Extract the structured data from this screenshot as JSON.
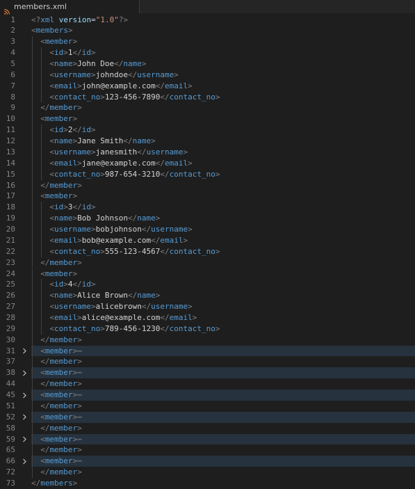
{
  "tab": {
    "filename": "members.xml",
    "icon": "rss-feed-icon"
  },
  "colors": {
    "background": "#1e1e1e",
    "tabbar": "#252526",
    "line_number": "#858585",
    "tag": "#569cd6",
    "punctuation": "#808080",
    "text": "#d4d4d4",
    "string": "#ce9178",
    "attribute": "#9cdcfe",
    "folded_highlight": "#26323d"
  },
  "lines": [
    {
      "n": "1",
      "indent": 0,
      "kind": "decl"
    },
    {
      "n": "2",
      "indent": 0,
      "kind": "open",
      "tag": "members"
    },
    {
      "n": "3",
      "indent": 1,
      "kind": "open",
      "tag": "member"
    },
    {
      "n": "4",
      "indent": 2,
      "kind": "el",
      "tag": "id",
      "text": "1"
    },
    {
      "n": "5",
      "indent": 2,
      "kind": "el",
      "tag": "name",
      "text": "John Doe"
    },
    {
      "n": "6",
      "indent": 2,
      "kind": "el",
      "tag": "username",
      "text": "johndoe"
    },
    {
      "n": "7",
      "indent": 2,
      "kind": "el",
      "tag": "email",
      "text": "john@example.com"
    },
    {
      "n": "8",
      "indent": 2,
      "kind": "el",
      "tag": "contact_no",
      "text": "123-456-7890"
    },
    {
      "n": "9",
      "indent": 1,
      "kind": "close",
      "tag": "member"
    },
    {
      "n": "10",
      "indent": 1,
      "kind": "open",
      "tag": "member"
    },
    {
      "n": "11",
      "indent": 2,
      "kind": "el",
      "tag": "id",
      "text": "2"
    },
    {
      "n": "12",
      "indent": 2,
      "kind": "el",
      "tag": "name",
      "text": "Jane Smith"
    },
    {
      "n": "13",
      "indent": 2,
      "kind": "el",
      "tag": "username",
      "text": "janesmith"
    },
    {
      "n": "14",
      "indent": 2,
      "kind": "el",
      "tag": "email",
      "text": "jane@example.com"
    },
    {
      "n": "15",
      "indent": 2,
      "kind": "el",
      "tag": "contact_no",
      "text": "987-654-3210"
    },
    {
      "n": "16",
      "indent": 1,
      "kind": "close",
      "tag": "member"
    },
    {
      "n": "17",
      "indent": 1,
      "kind": "open",
      "tag": "member"
    },
    {
      "n": "18",
      "indent": 2,
      "kind": "el",
      "tag": "id",
      "text": "3"
    },
    {
      "n": "19",
      "indent": 2,
      "kind": "el",
      "tag": "name",
      "text": "Bob Johnson"
    },
    {
      "n": "20",
      "indent": 2,
      "kind": "el",
      "tag": "username",
      "text": "bobjohnson"
    },
    {
      "n": "21",
      "indent": 2,
      "kind": "el",
      "tag": "email",
      "text": "bob@example.com"
    },
    {
      "n": "22",
      "indent": 2,
      "kind": "el",
      "tag": "contact_no",
      "text": "555-123-4567"
    },
    {
      "n": "23",
      "indent": 1,
      "kind": "close",
      "tag": "member"
    },
    {
      "n": "24",
      "indent": 1,
      "kind": "open",
      "tag": "member"
    },
    {
      "n": "25",
      "indent": 2,
      "kind": "el",
      "tag": "id",
      "text": "4"
    },
    {
      "n": "26",
      "indent": 2,
      "kind": "el",
      "tag": "name",
      "text": "Alice Brown"
    },
    {
      "n": "27",
      "indent": 2,
      "kind": "el",
      "tag": "username",
      "text": "alicebrown"
    },
    {
      "n": "28",
      "indent": 2,
      "kind": "el",
      "tag": "email",
      "text": "alice@example.com"
    },
    {
      "n": "29",
      "indent": 2,
      "kind": "el",
      "tag": "contact_no",
      "text": "789-456-1230"
    },
    {
      "n": "30",
      "indent": 1,
      "kind": "close",
      "tag": "member"
    },
    {
      "n": "31",
      "indent": 1,
      "kind": "folded",
      "tag": "member",
      "ellipsis": "⋯"
    },
    {
      "n": "37",
      "indent": 1,
      "kind": "close",
      "tag": "member"
    },
    {
      "n": "38",
      "indent": 1,
      "kind": "folded",
      "tag": "member",
      "ellipsis": "⋯"
    },
    {
      "n": "44",
      "indent": 1,
      "kind": "close",
      "tag": "member"
    },
    {
      "n": "45",
      "indent": 1,
      "kind": "folded",
      "tag": "member",
      "ellipsis": "⋯"
    },
    {
      "n": "51",
      "indent": 1,
      "kind": "close",
      "tag": "member"
    },
    {
      "n": "52",
      "indent": 1,
      "kind": "folded",
      "tag": "member",
      "ellipsis": "⋯"
    },
    {
      "n": "58",
      "indent": 1,
      "kind": "close",
      "tag": "member"
    },
    {
      "n": "59",
      "indent": 1,
      "kind": "folded",
      "tag": "member",
      "ellipsis": "⋯"
    },
    {
      "n": "65",
      "indent": 1,
      "kind": "close",
      "tag": "member"
    },
    {
      "n": "66",
      "indent": 1,
      "kind": "folded",
      "tag": "member",
      "ellipsis": "⋯"
    },
    {
      "n": "72",
      "indent": 1,
      "kind": "close",
      "tag": "member"
    },
    {
      "n": "73",
      "indent": 0,
      "kind": "close",
      "tag": "members"
    }
  ],
  "xml_decl": {
    "name": "xml",
    "attr": "version",
    "value": "\"1.0\""
  }
}
